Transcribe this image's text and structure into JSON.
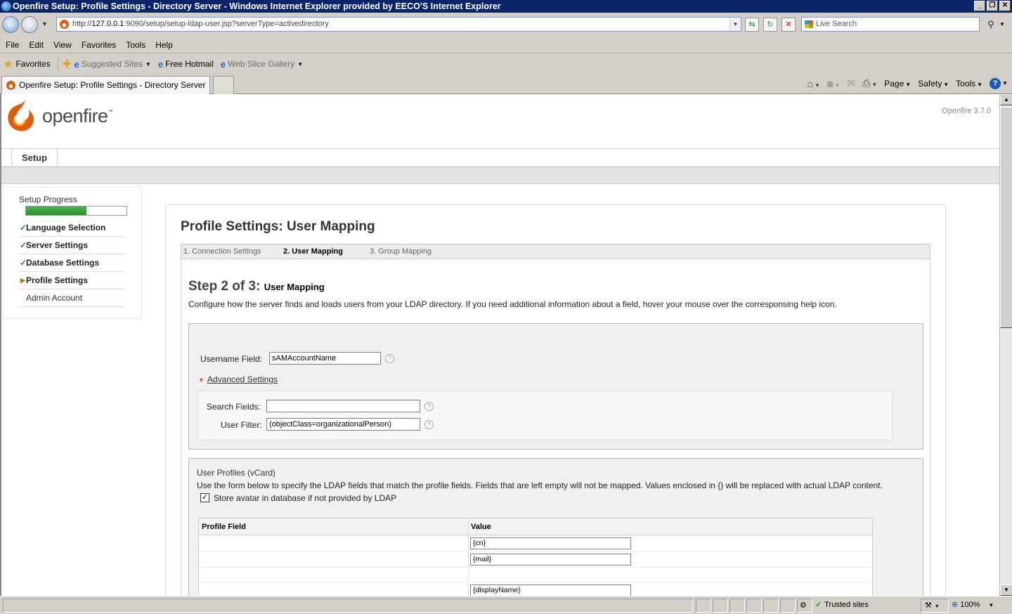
{
  "window": {
    "title": "Openfire Setup: Profile Settings - Directory Server - Windows Internet Explorer provided by EECO'S Internet Explorer",
    "controls": [
      "minimize",
      "restore",
      "close"
    ]
  },
  "browser": {
    "address_prefix": "http://",
    "address_host": "127.0.0.1",
    "address_path": ":9090/setup/setup-ldap-user.jsp?serverType=activedirectory",
    "search_placeholder": "Live Search",
    "menu": [
      "File",
      "Edit",
      "View",
      "Favorites",
      "Tools",
      "Help"
    ],
    "favorites_label": "Favorites",
    "fav_links": [
      "Suggested Sites",
      "Free Hotmail",
      "Web Slice Gallery"
    ],
    "tab_title": "Openfire Setup: Profile Settings - Directory Server",
    "cmd_items": [
      "Page",
      "Safety",
      "Tools"
    ],
    "status": {
      "zone": "Trusted sites",
      "zoom": "100%"
    }
  },
  "app": {
    "logo_text": "openfire",
    "logo_tm": "™",
    "version": "Openfire 3.7.0",
    "top_tab": "Setup"
  },
  "sidebar": {
    "title": "Setup Progress",
    "progress_percent": 60,
    "items": [
      {
        "label": "Language Selection",
        "state": "done"
      },
      {
        "label": "Server Settings",
        "state": "done"
      },
      {
        "label": "Database Settings",
        "state": "done"
      },
      {
        "label": "Profile Settings",
        "state": "current"
      },
      {
        "label": "Admin Account",
        "state": "todo"
      }
    ]
  },
  "main": {
    "heading": "Profile Settings: User Mapping",
    "steps": [
      "1. Connection Settings",
      "2. User Mapping",
      "3. Group Mapping"
    ],
    "step_heading": "Step 2 of 3:",
    "step_subheading": "User Mapping",
    "step_desc": "Configure how the server finds and loads users from your LDAP directory. If you need additional information about a field, hover your mouse over the corresponsing help icon.",
    "username_label": "Username Field:",
    "username_value": "sAMAccountName",
    "advanced_label": "Advanced Settings",
    "search_fields_label": "Search Fields:",
    "search_fields_value": "",
    "user_filter_label": "User Filter:",
    "user_filter_value": "(objectClass=organizationalPerson)",
    "help_glyph": "?"
  },
  "vcard": {
    "title": "User Profiles (vCard)",
    "desc": "Use the form below to specify the LDAP fields that match the profile fields. Fields that are left empty will not be mapped. Values enclosed in {} will be replaced with actual LDAP content.",
    "store_avatar_label": "Store avatar in database if not provided by LDAP",
    "store_avatar_checked": true,
    "col_profile_field": "Profile Field",
    "col_value": "Value",
    "rows": [
      {
        "field": "",
        "value": "{cn}"
      },
      {
        "field": "",
        "value": "{mail}"
      },
      {
        "field": "",
        "value": null
      },
      {
        "field": "",
        "value": "{displayName}"
      }
    ]
  },
  "colors": {
    "brand_orange": "#e25a0b",
    "progress_green": "#2c8f2c"
  }
}
